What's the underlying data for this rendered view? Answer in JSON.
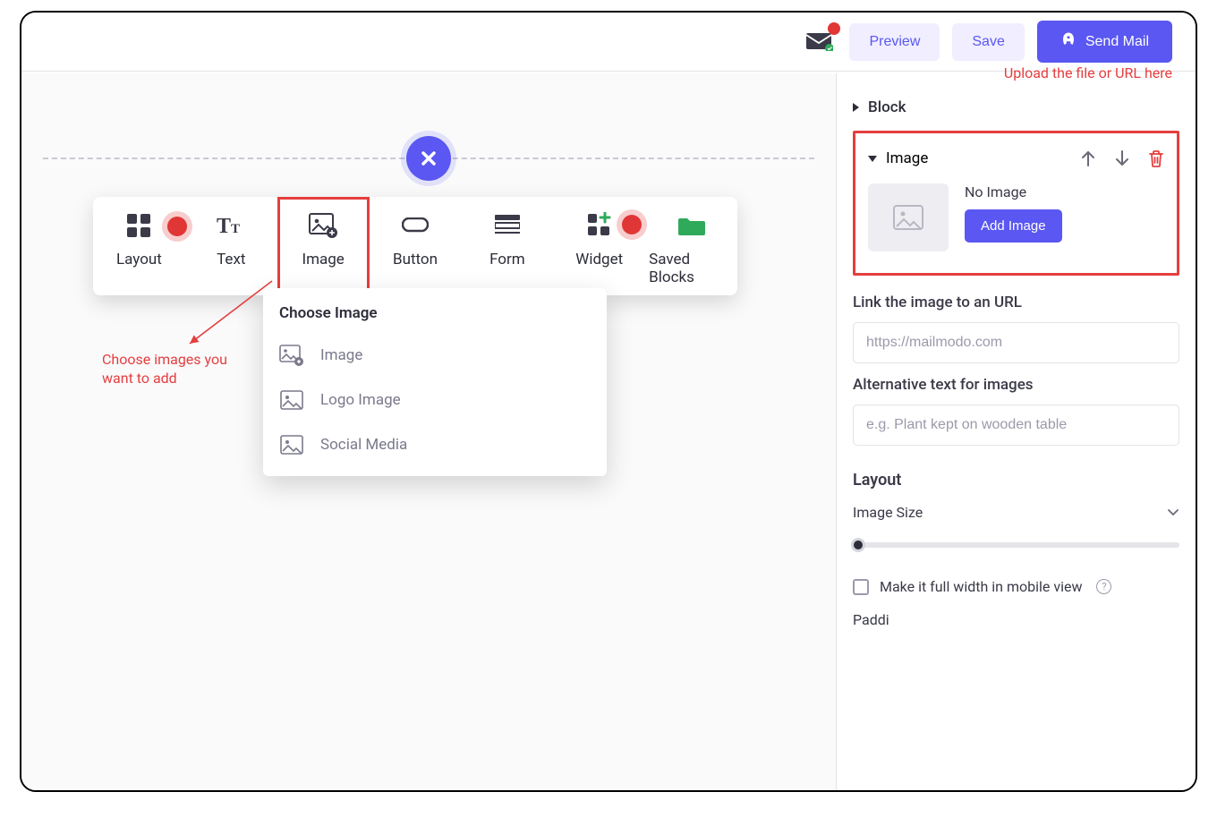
{
  "topbar": {
    "preview": "Preview",
    "save": "Save",
    "sendMail": "Send Mail"
  },
  "toolbar": {
    "items": [
      {
        "label": "Layout"
      },
      {
        "label": "Text"
      },
      {
        "label": "Image"
      },
      {
        "label": "Button"
      },
      {
        "label": "Form"
      },
      {
        "label": "Widget"
      },
      {
        "label": "Saved Blocks"
      }
    ]
  },
  "dropdown": {
    "title": "Choose Image",
    "items": [
      {
        "label": "Image"
      },
      {
        "label": "Logo Image"
      },
      {
        "label": "Social Media"
      }
    ]
  },
  "annotations": {
    "left": "Choose images you want to add",
    "right": "Upload the file or URL here"
  },
  "side": {
    "blockTitle": "Block",
    "image": {
      "title": "Image",
      "noImage": "No Image",
      "addImage": "Add Image"
    },
    "linkLabel": "Link the image to an URL",
    "linkPlaceholder": "https://mailmodo.com",
    "altLabel": "Alternative text for images",
    "altPlaceholder": "e.g. Plant kept on wooden table",
    "layoutTitle": "Layout",
    "imageSize": "Image Size",
    "fullWidthMobile": "Make it full width in mobile view",
    "paddingPartial": "Paddi"
  }
}
